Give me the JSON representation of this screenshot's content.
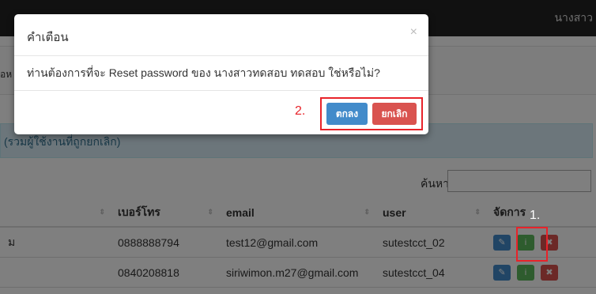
{
  "topbar": {
    "user_text": "นางสาว"
  },
  "background": {
    "fragment": "อห",
    "notice": "(รวมผู้ใช้งานที่ถูกยกเลิก)",
    "search_label": "ค้นหา:",
    "table": {
      "headers": [
        "",
        "เบอร์โทร",
        "email",
        "user",
        "จัดการ"
      ],
      "rows": [
        {
          "first": "ม",
          "phone": "0888888794",
          "email": "test12@gmail.com",
          "user": "sutestcct_02"
        },
        {
          "first": "",
          "phone": "0840208818",
          "email": "siriwimon.m27@gmail.com",
          "user": "sutestcct_04"
        }
      ]
    }
  },
  "annotations": {
    "label1": "1.",
    "label2": "2."
  },
  "modal": {
    "title": "คำเตือน",
    "close": "×",
    "message": "ท่านต้องการที่จะ Reset password ของ นางสาวทดสอบ ทดสอบ ใช่หรือไม่?",
    "ok_label": "ตกลง",
    "cancel_label": "ยกเลิก"
  },
  "icons": {
    "edit": "✎",
    "info": "i",
    "delete": "✖",
    "sort": "⇕"
  },
  "colors": {
    "primary": "#428bca",
    "success": "#5cb85c",
    "danger": "#d9534f",
    "highlight": "#e8232a"
  }
}
